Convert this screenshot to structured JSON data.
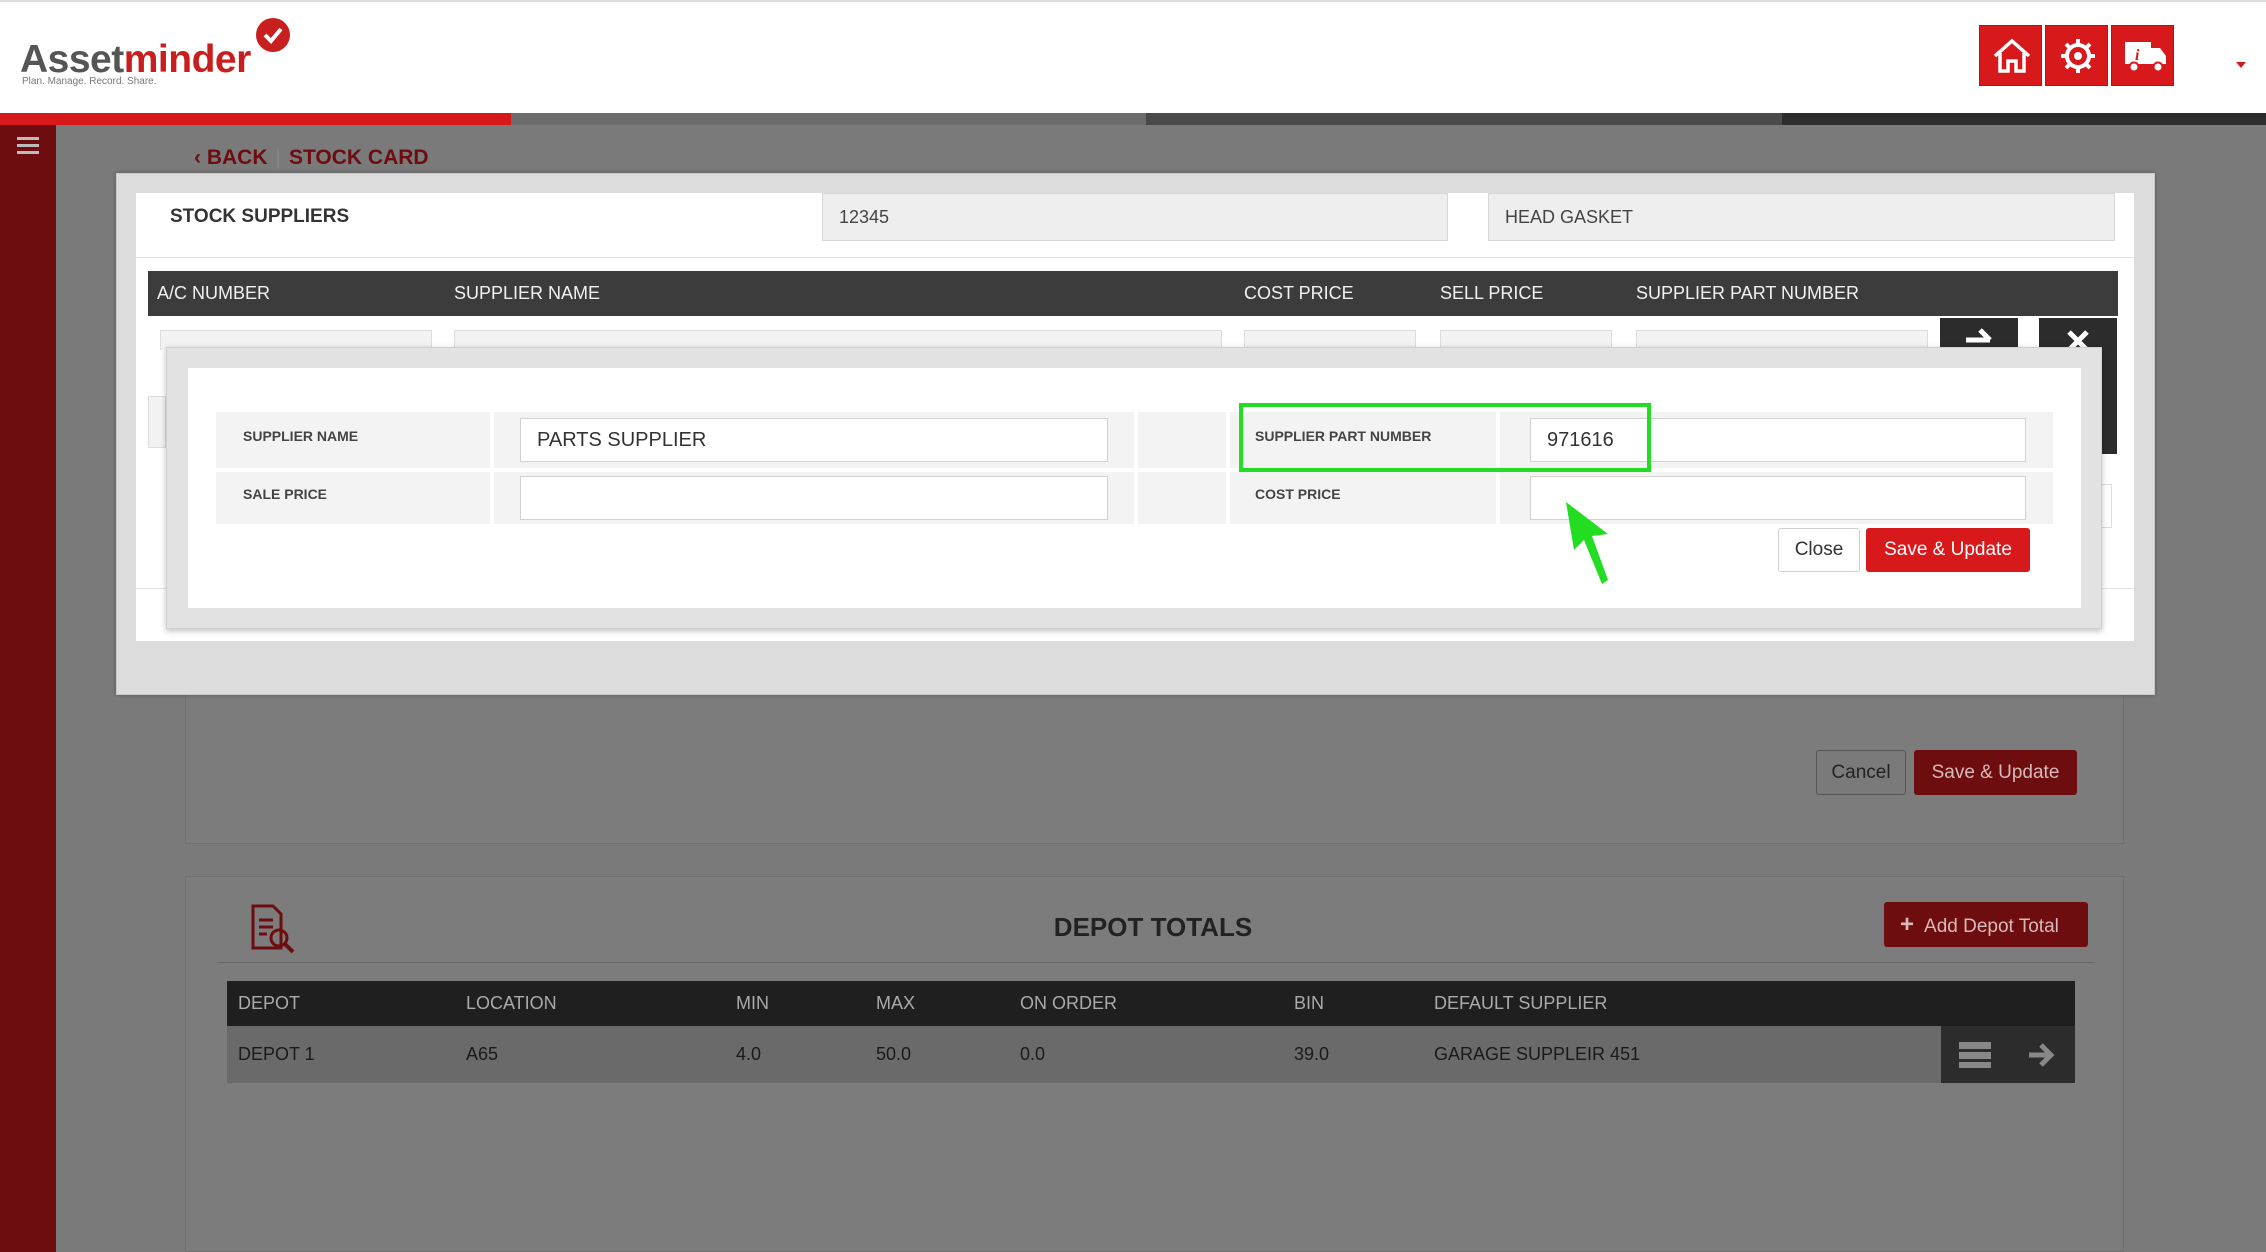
{
  "brand": {
    "name_part1": "Asset",
    "name_part2": "minder",
    "tagline": "Plan. Manage. Record. Share."
  },
  "header": {
    "buttons": [
      {
        "name": "home-icon"
      },
      {
        "name": "settings-gear-icon"
      },
      {
        "name": "truck-info-icon"
      }
    ],
    "user_menu_caret": "chevron-down-icon"
  },
  "breadcrumb": {
    "back_label": "BACK",
    "current": "STOCK CARD"
  },
  "stock_suppliers_modal": {
    "title": "STOCK SUPPLIERS",
    "part_code": "12345",
    "part_description": "HEAD GASKET",
    "columns": [
      "A/C NUMBER",
      "SUPPLIER NAME",
      "COST PRICE",
      "SELL PRICE",
      "SUPPLIER PART NUMBER"
    ]
  },
  "edit_supplier_dialog": {
    "supplier_name_label": "SUPPLIER NAME",
    "supplier_name_value": "PARTS SUPPLIER",
    "supplier_part_number_label": "SUPPLIER PART NUMBER",
    "supplier_part_number_value": "971616",
    "sale_price_label": "SALE PRICE",
    "sale_price_value": "",
    "cost_price_label": "COST PRICE",
    "cost_price_value": "",
    "close_label": "Close",
    "save_label": "Save & Update"
  },
  "underlying_form": {
    "cancel_label": "Cancel",
    "save_label": "Save & Update"
  },
  "depot_totals": {
    "title": "DEPOT TOTALS",
    "add_label": "Add Depot Total",
    "columns": [
      "DEPOT",
      "LOCATION",
      "MIN",
      "MAX",
      "ON ORDER",
      "BIN",
      "DEFAULT SUPPLIER"
    ],
    "rows": [
      [
        "DEPOT 1",
        "A65",
        "4.0",
        "50.0",
        "0.0",
        "39.0",
        "GARAGE SUPPLEIR 451"
      ]
    ]
  },
  "colors": {
    "brand_red": "#d7191c",
    "dark_red": "#6e0d0f",
    "highlight_green": "#22dd22"
  }
}
